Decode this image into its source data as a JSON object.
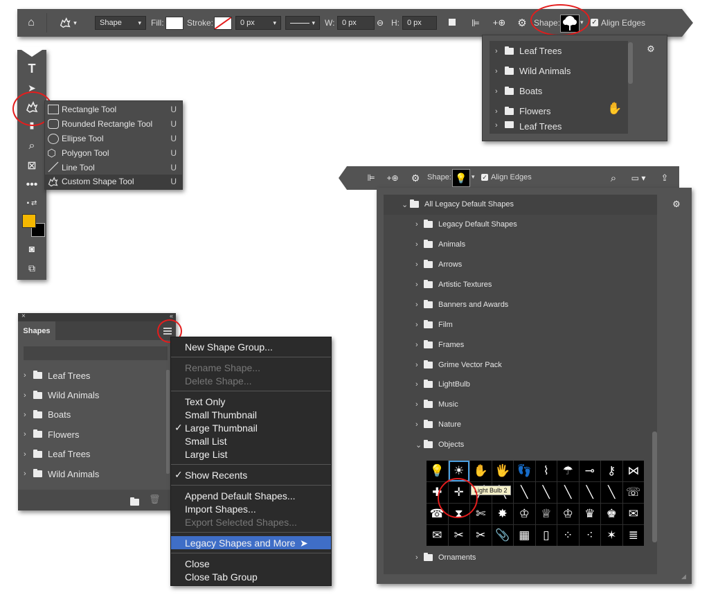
{
  "options_bar": {
    "mode_select": "Shape",
    "fill_label": "Fill:",
    "stroke_label": "Stroke:",
    "stroke_width": "0 px",
    "w_label": "W:",
    "w_value": "0 px",
    "h_label": "H:",
    "h_value": "0 px",
    "shape_label": "Shape:",
    "align_edges": "Align Edges"
  },
  "shape_picker_top": {
    "items": [
      "Leaf Trees",
      "Wild Animals",
      "Boats",
      "Flowers",
      "Leaf Trees"
    ]
  },
  "toolbar": {
    "text_tool_glyph": "T"
  },
  "shape_tools_flyout": {
    "items": [
      {
        "label": "Rectangle Tool",
        "shortcut": "U"
      },
      {
        "label": "Rounded Rectangle Tool",
        "shortcut": "U"
      },
      {
        "label": "Ellipse Tool",
        "shortcut": "U"
      },
      {
        "label": "Polygon Tool",
        "shortcut": "U"
      },
      {
        "label": "Line Tool",
        "shortcut": "U"
      },
      {
        "label": "Custom Shape Tool",
        "shortcut": "U"
      }
    ]
  },
  "shapes_panel": {
    "tab": "Shapes",
    "items": [
      "Leaf Trees",
      "Wild Animals",
      "Boats",
      "Flowers",
      "Leaf Trees",
      "Wild Animals"
    ]
  },
  "panel_menu": {
    "new_shape_group": "New Shape Group...",
    "rename_shape": "Rename Shape...",
    "delete_shape": "Delete Shape...",
    "text_only": "Text Only",
    "small_thumbnail": "Small Thumbnail",
    "large_thumbnail": "Large Thumbnail",
    "small_list": "Small List",
    "large_list": "Large List",
    "show_recents": "Show Recents",
    "append_default": "Append Default Shapes...",
    "import_shapes": "Import Shapes...",
    "export_selected": "Export Selected Shapes...",
    "legacy_shapes": "Legacy Shapes and More",
    "close": "Close",
    "close_tab_group": "Close Tab Group",
    "checkmark": "✓"
  },
  "legacy_picker": {
    "shape_label": "Shape:",
    "align_edges": "Align Edges",
    "root": "All Legacy Default Shapes",
    "groups": [
      "Legacy Default Shapes",
      "Animals",
      "Arrows",
      "Artistic Textures",
      "Banners and Awards",
      "Film",
      "Frames",
      "Grime Vector Pack",
      "LightBulb",
      "Music",
      "Nature"
    ],
    "objects_group": "Objects",
    "tooltip": "Light Bulb 2",
    "after_group": "Ornaments"
  },
  "colors": {
    "panel_bg": "#535353",
    "menu_bg": "#2b2b2b",
    "highlight": "#3f6ec7",
    "foreground_color": "#f5b800",
    "annotation_red": "#e41d1d"
  }
}
